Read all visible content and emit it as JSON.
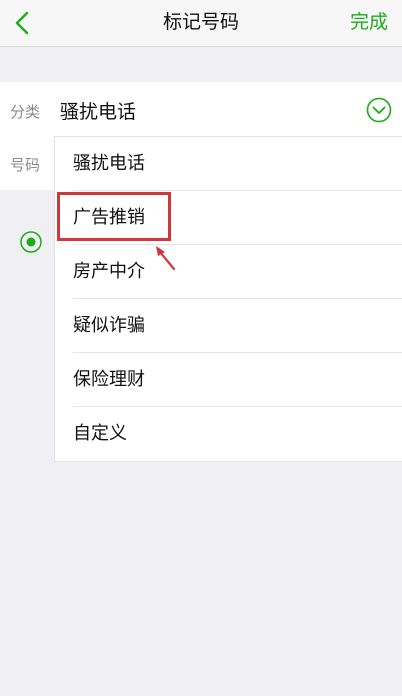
{
  "nav": {
    "title": "标记号码",
    "done_label": "完成",
    "back_icon": "chevron-left-icon"
  },
  "form": {
    "category_label": "分类",
    "category_value": "骚扰电话",
    "number_label": "号码"
  },
  "menu": {
    "items": [
      {
        "label": "骚扰电话"
      },
      {
        "label": "广告推销"
      },
      {
        "label": "房产中介"
      },
      {
        "label": "疑似诈骗"
      },
      {
        "label": "保险理财"
      },
      {
        "label": "自定义"
      }
    ]
  },
  "colors": {
    "accent": "#1aad19",
    "highlight": "#d0373c"
  }
}
